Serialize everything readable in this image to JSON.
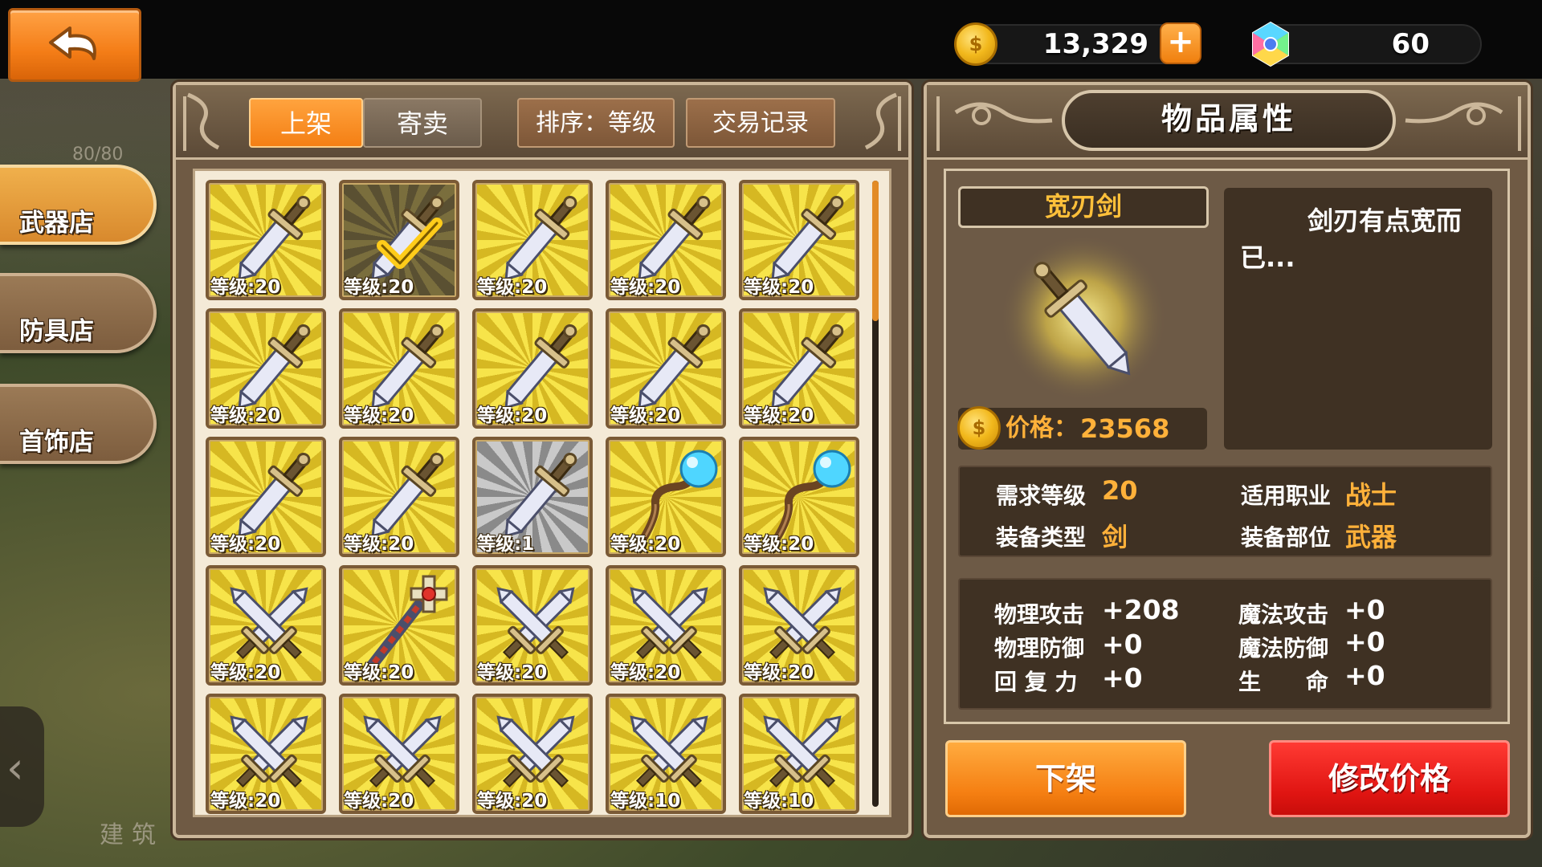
{
  "resources": {
    "gold": "13,329",
    "gold_add": "+",
    "gems": "60"
  },
  "sidebar": {
    "count_text": "80/80",
    "tabs": [
      {
        "label": "武器店",
        "active": true
      },
      {
        "label": "防具店",
        "active": false
      },
      {
        "label": "首饰店",
        "active": false
      }
    ],
    "build_label": "建筑"
  },
  "market": {
    "tabs": {
      "list": "上架",
      "consign": "寄卖"
    },
    "sort_button": "排序：等级",
    "history_button": "交易记录",
    "items": [
      {
        "icon": "sword-icon",
        "level": "等级:20",
        "state": "normal"
      },
      {
        "icon": "sword-icon",
        "level": "等级:20",
        "state": "selected"
      },
      {
        "icon": "sword-icon",
        "level": "等级:20",
        "state": "normal"
      },
      {
        "icon": "sword-icon",
        "level": "等级:20",
        "state": "normal"
      },
      {
        "icon": "sword-icon",
        "level": "等级:20",
        "state": "normal"
      },
      {
        "icon": "sword-icon",
        "level": "等级:20",
        "state": "normal"
      },
      {
        "icon": "sword-icon",
        "level": "等级:20",
        "state": "normal"
      },
      {
        "icon": "sword-icon",
        "level": "等级:20",
        "state": "normal"
      },
      {
        "icon": "sword-icon",
        "level": "等级:20",
        "state": "normal"
      },
      {
        "icon": "sword-icon",
        "level": "等级:20",
        "state": "normal"
      },
      {
        "icon": "sword-icon",
        "level": "等级:20",
        "state": "normal"
      },
      {
        "icon": "sword-icon",
        "level": "等级:20",
        "state": "normal"
      },
      {
        "icon": "sword-icon",
        "level": "等级:1",
        "state": "gray"
      },
      {
        "icon": "staff-icon",
        "level": "等级:20",
        "state": "normal"
      },
      {
        "icon": "staff-icon",
        "level": "等级:20",
        "state": "normal"
      },
      {
        "icon": "crossed-swords-icon",
        "level": "等级:20",
        "state": "normal"
      },
      {
        "icon": "scepter-icon",
        "level": "等级:20",
        "state": "normal"
      },
      {
        "icon": "crossed-swords-icon",
        "level": "等级:20",
        "state": "normal"
      },
      {
        "icon": "crossed-swords-icon",
        "level": "等级:20",
        "state": "normal"
      },
      {
        "icon": "crossed-swords-icon",
        "level": "等级:20",
        "state": "normal"
      },
      {
        "icon": "crossed-swords-icon",
        "level": "等级:20",
        "state": "normal"
      },
      {
        "icon": "crossed-swords-icon",
        "level": "等级:20",
        "state": "normal"
      },
      {
        "icon": "crossed-swords-icon",
        "level": "等级:20",
        "state": "normal"
      },
      {
        "icon": "crossed-swords-icon",
        "level": "等级:10",
        "state": "normal"
      },
      {
        "icon": "crossed-swords-icon",
        "level": "等级:10",
        "state": "normal"
      }
    ]
  },
  "detail": {
    "title": "物品属性",
    "item_name": "宽刃剑",
    "price_label": "价格：",
    "price": "23568",
    "description": "剑刃有点宽而已...",
    "requirements": {
      "req_level_label": "需求等级",
      "req_level": "20",
      "class_label": "适用职业",
      "class": "战士",
      "type_label": "装备类型",
      "type": "剑",
      "slot_label": "装备部位",
      "slot": "武器"
    },
    "stats": {
      "phys_atk_label": "物理攻击",
      "phys_atk": "+208",
      "mag_atk_label": "魔法攻击",
      "mag_atk": "+0",
      "phys_def_label": "物理防御",
      "phys_def": "+0",
      "mag_def_label": "魔法防御",
      "mag_def": "+0",
      "regen_label": "回 复 力",
      "regen": "+0",
      "hp_label": "生　　命",
      "hp": "+0"
    },
    "unlist_button": "下架",
    "modify_price_button": "修改价格"
  },
  "colors": {
    "accent_orange": "#f47f14",
    "danger_red": "#e01512",
    "gold_text": "#ffb13a",
    "panel_brown": "#6f5a44"
  }
}
